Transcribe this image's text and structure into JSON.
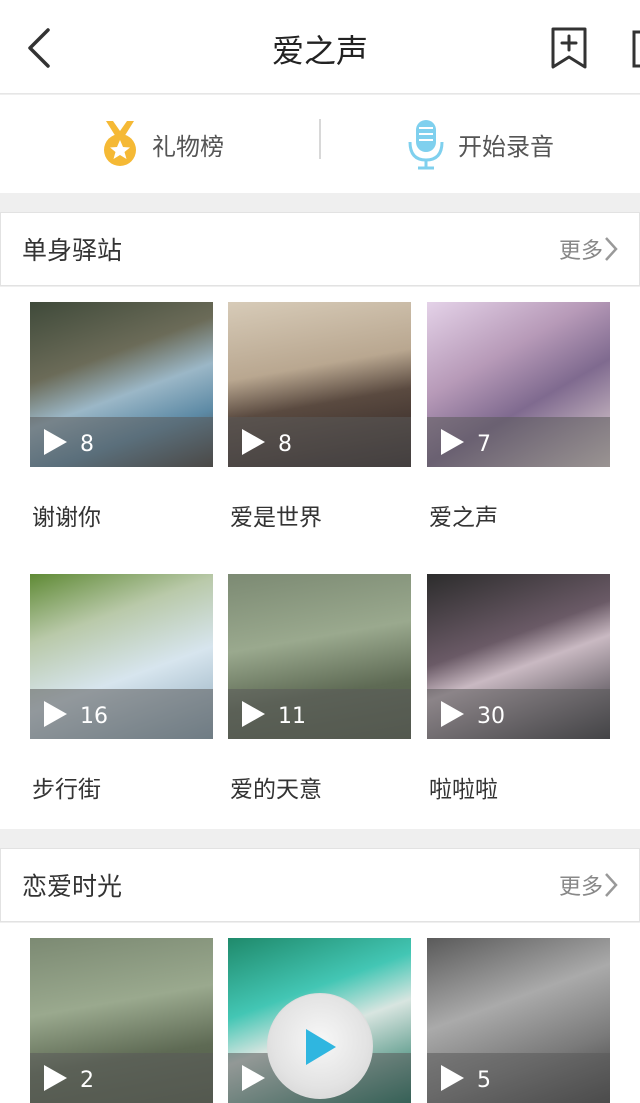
{
  "header": {
    "title": "爱之声",
    "back_icon": "chevron-left-icon",
    "bookmark_icon": "bookmark-plus-icon"
  },
  "actions": {
    "gift": {
      "label": "礼物榜",
      "icon": "medal-icon",
      "icon_color": "#f5b935"
    },
    "record": {
      "label": "开始录音",
      "icon": "microphone-icon",
      "icon_color": "#7fd0ee"
    }
  },
  "sections": [
    {
      "title": "单身驿站",
      "more": "更多",
      "items": [
        {
          "name": "谢谢你",
          "count": "8"
        },
        {
          "name": "爱是世界",
          "count": "8"
        },
        {
          "name": "爱之声",
          "count": "7"
        },
        {
          "name": "步行街",
          "count": "16"
        },
        {
          "name": "爱的天意",
          "count": "11"
        },
        {
          "name": "啦啦啦",
          "count": "30"
        }
      ]
    },
    {
      "title": "恋爱时光",
      "more": "更多",
      "items": [
        {
          "name": "",
          "count": "2"
        },
        {
          "name": "",
          "count": ""
        },
        {
          "name": "",
          "count": "5"
        }
      ]
    }
  ]
}
